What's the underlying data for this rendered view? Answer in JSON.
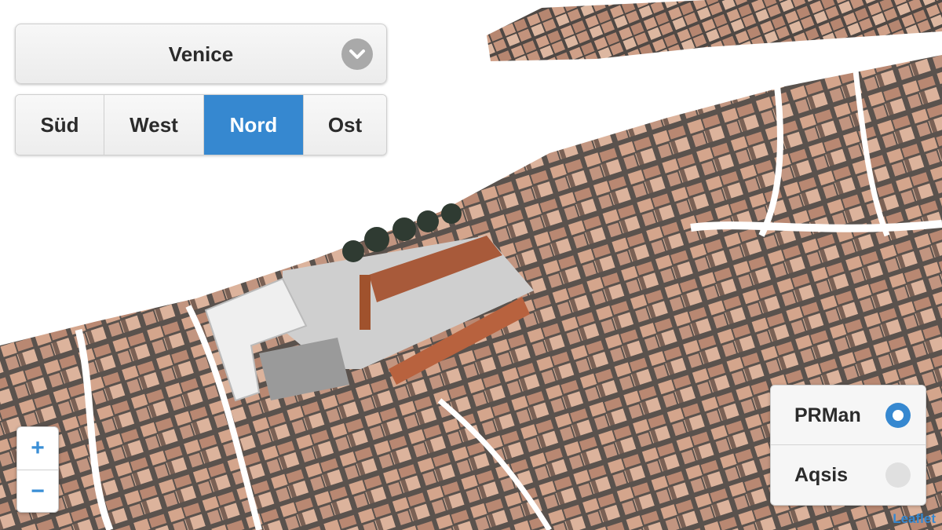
{
  "map": {
    "description_icon": "3d-city-map",
    "colors": {
      "roof": "#c89a82",
      "roof_dark": "#8a6a5a",
      "ground": "#6b6b6b",
      "canal": "#ffffff",
      "accent": "#3688d0"
    }
  },
  "city_select": {
    "value": "Venice",
    "icon": "chevron-down-icon"
  },
  "directions": {
    "active": "Nord",
    "items": [
      {
        "label": "Süd"
      },
      {
        "label": "West"
      },
      {
        "label": "Nord"
      },
      {
        "label": "Ost"
      }
    ]
  },
  "zoom": {
    "in_label": "+",
    "out_label": "−"
  },
  "renderer": {
    "selected": "PRMan",
    "options": [
      {
        "label": "PRMan"
      },
      {
        "label": "Aqsis"
      }
    ]
  },
  "attribution": {
    "label": "Leaflet"
  }
}
